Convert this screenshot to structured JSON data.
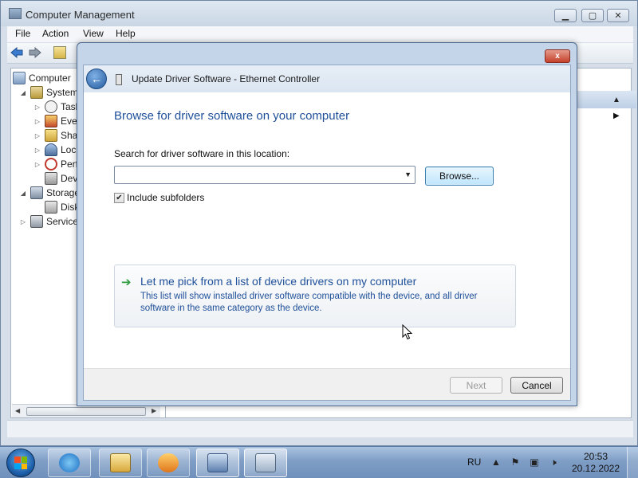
{
  "computer_management": {
    "title": "Computer Management",
    "menu": [
      "File",
      "Action",
      "View",
      "Help"
    ],
    "tree": [
      {
        "label": "Computer",
        "icon": "computer-icon"
      },
      {
        "label": "System",
        "icon": "tools-icon"
      },
      {
        "label": "Task",
        "icon": "clock-icon"
      },
      {
        "label": "Even",
        "icon": "event-viewer-icon"
      },
      {
        "label": "Sha",
        "icon": "shared-folder-icon"
      },
      {
        "label": "Loc",
        "icon": "users-icon"
      },
      {
        "label": "Perf",
        "icon": "performance-icon"
      },
      {
        "label": "Dev",
        "icon": "device-manager-icon"
      },
      {
        "label": "Storage",
        "icon": "storage-icon"
      },
      {
        "label": "Disk",
        "icon": "disk-icon"
      },
      {
        "label": "Services",
        "icon": "services-icon"
      }
    ]
  },
  "dialog": {
    "title": "Update Driver Software - Ethernet Controller",
    "heading": "Browse for driver software on your computer",
    "search_label": "Search for driver software in this location:",
    "path_value": "",
    "browse_label": "Browse...",
    "include_subfolders_label": "Include subfolders",
    "include_subfolders_checked": true,
    "pick_title": "Let me pick from a list of device drivers on my computer",
    "pick_desc": "This list will show installed driver software compatible with the device, and all driver software in the same category as the device.",
    "next_label": "Next",
    "cancel_label": "Cancel",
    "close_glyph": "x"
  },
  "taskbar": {
    "pinned": [
      {
        "name": "internet-explorer-icon"
      },
      {
        "name": "windows-explorer-icon"
      },
      {
        "name": "media-player-icon"
      },
      {
        "name": "computer-management-icon"
      },
      {
        "name": "device-dialog-icon"
      }
    ],
    "language": "RU",
    "time": "20:53",
    "date": "20.12.2022"
  },
  "colors": {
    "heading_blue": "#1e4f99",
    "link_green": "#2e9b3c"
  }
}
